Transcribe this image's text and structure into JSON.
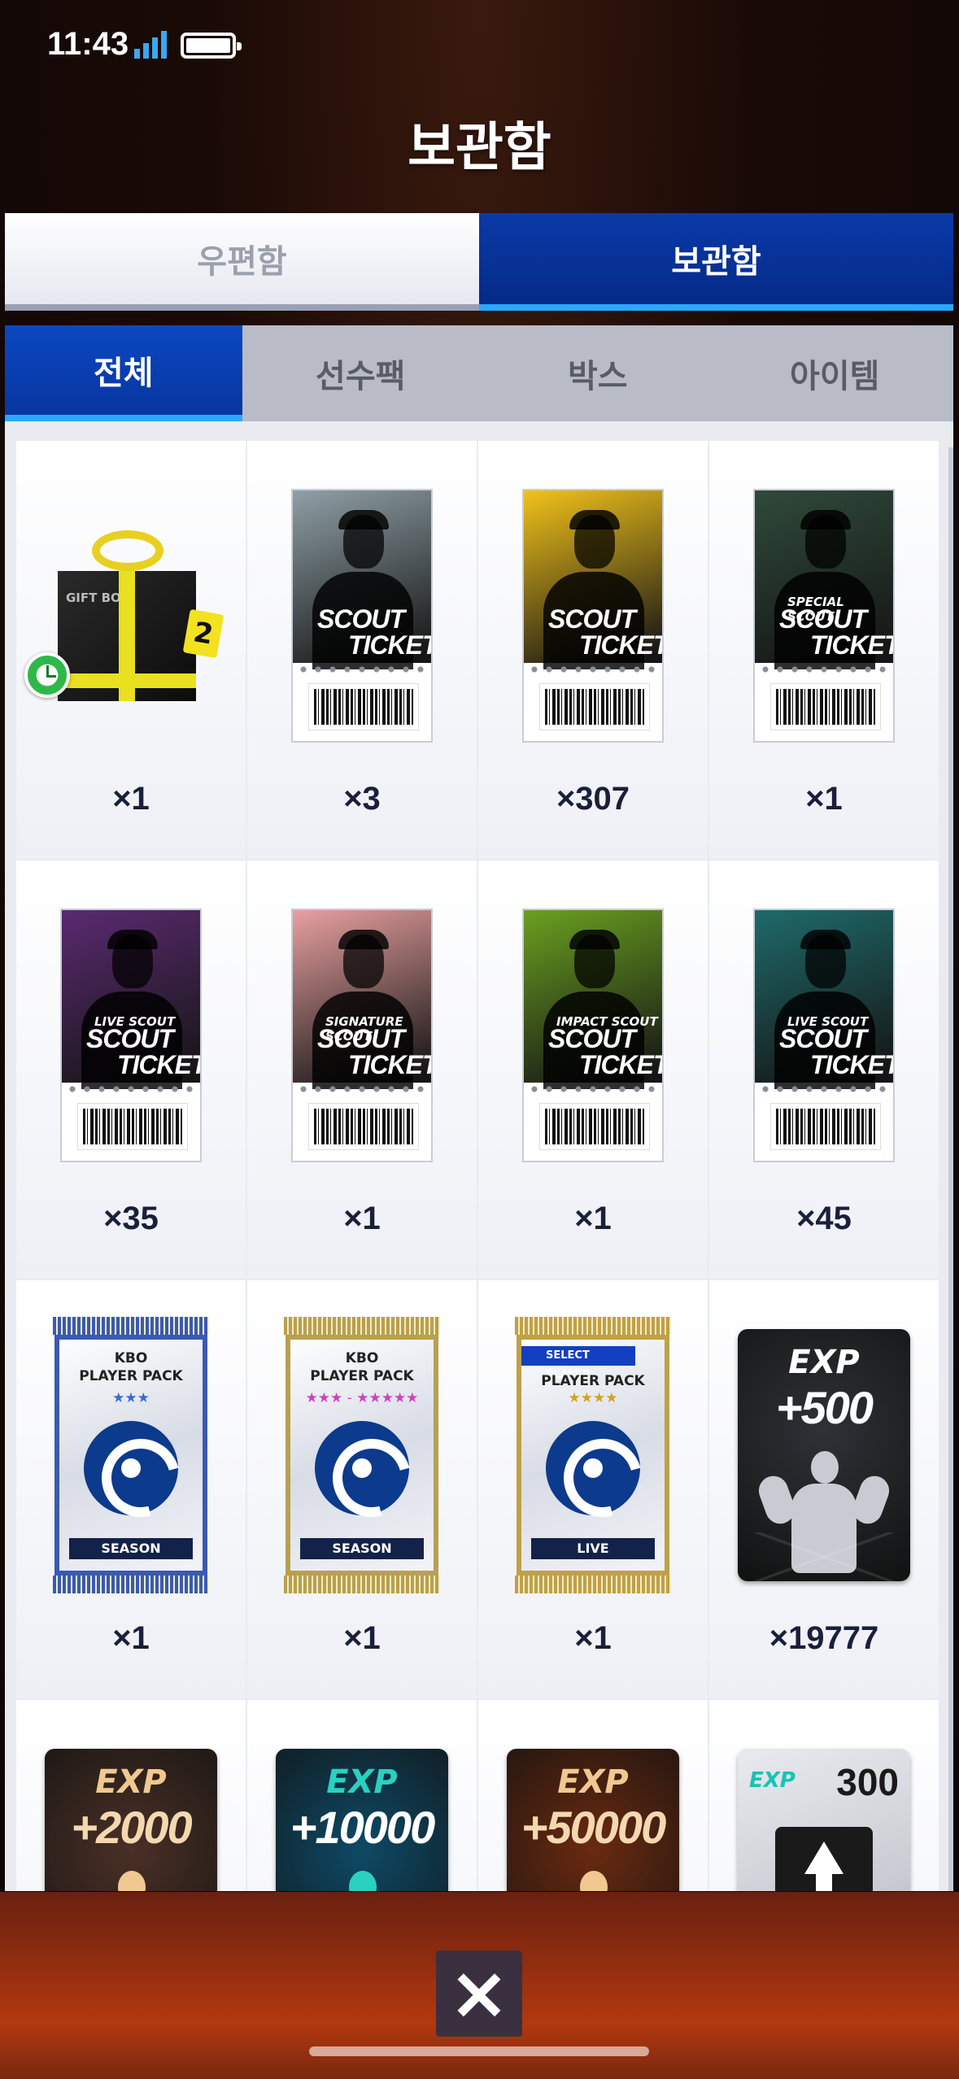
{
  "status_bar": {
    "time": "11:43"
  },
  "header": {
    "title": "보관함"
  },
  "top_tabs": [
    {
      "label": "우편함",
      "active": false
    },
    {
      "label": "보관함",
      "active": true
    }
  ],
  "sub_tabs": [
    {
      "label": "전체",
      "active": true
    },
    {
      "label": "선수팩",
      "active": false
    },
    {
      "label": "박스",
      "active": false
    },
    {
      "label": "아이템",
      "active": false
    }
  ],
  "items": [
    {
      "name": "gift-box",
      "count": "×1",
      "box_text": "GIFT BOX",
      "tag": "2",
      "has_timer": true
    },
    {
      "name": "scout-ticket-basic",
      "count": "×3",
      "sub": "",
      "line1": "SCOUT",
      "line2": "TICKET",
      "color": "#8fa0a6"
    },
    {
      "name": "scout-ticket-gold",
      "count": "×307",
      "sub": "",
      "line1": "SCOUT",
      "line2": "TICKET",
      "color": "#f2c21a"
    },
    {
      "name": "scout-ticket-special",
      "count": "×1",
      "sub": "SPECIAL SCOUT",
      "line1": "SCOUT",
      "line2": "TICKET",
      "color": "#2f4a3a"
    },
    {
      "name": "scout-ticket-live-purple",
      "count": "×35",
      "sub": "LIVE SCOUT",
      "line1": "SCOUT",
      "line2": "TICKET",
      "color": "#5a2a70"
    },
    {
      "name": "scout-ticket-signature",
      "count": "×1",
      "sub": "SIGNATURE SCOUT",
      "line1": "SCOUT",
      "line2": "TICKET",
      "color": "#e8a0a0"
    },
    {
      "name": "scout-ticket-impact",
      "count": "×1",
      "sub": "IMPACT SCOUT",
      "line1": "SCOUT",
      "line2": "TICKET",
      "color": "#6aa020"
    },
    {
      "name": "scout-ticket-live-teal",
      "count": "×45",
      "sub": "LIVE SCOUT",
      "line1": "SCOUT",
      "line2": "TICKET",
      "color": "#1f6a6a"
    },
    {
      "name": "kbo-pack-season-blue",
      "count": "×1",
      "title": "KBO\nPLAYER PACK",
      "stars": "★★★",
      "band": "SEASON",
      "foil": "#3a5ab0"
    },
    {
      "name": "kbo-pack-season-gold",
      "count": "×1",
      "title": "KBO\nPLAYER PACK",
      "stars": "★★★ - ★★★★★",
      "band": "SEASON",
      "foil": "#b8a050"
    },
    {
      "name": "select-pack-live",
      "count": "×1",
      "badge": "SELECT PLAYER",
      "title": "PLAYER PACK",
      "stars": "★★★★",
      "band": "LIVE",
      "foil": "#c0a048"
    },
    {
      "name": "exp-500",
      "count": "×19777",
      "label": "EXP",
      "value": "+500",
      "color": "#2e3236"
    },
    {
      "name": "exp-2000",
      "count": "",
      "label": "EXP",
      "value": "+2000",
      "color": "#4a3026"
    },
    {
      "name": "exp-10000",
      "count": "",
      "label": "EXP",
      "value": "+10000",
      "color": "#0e4a66"
    },
    {
      "name": "exp-50000",
      "count": "",
      "label": "EXP",
      "value": "+50000",
      "color": "#6a2a10"
    },
    {
      "name": "exp-300",
      "count": "",
      "label": "EXP",
      "value": "300",
      "color": "#c8ccd2"
    }
  ],
  "footer": {
    "close_icon": "close-icon"
  }
}
